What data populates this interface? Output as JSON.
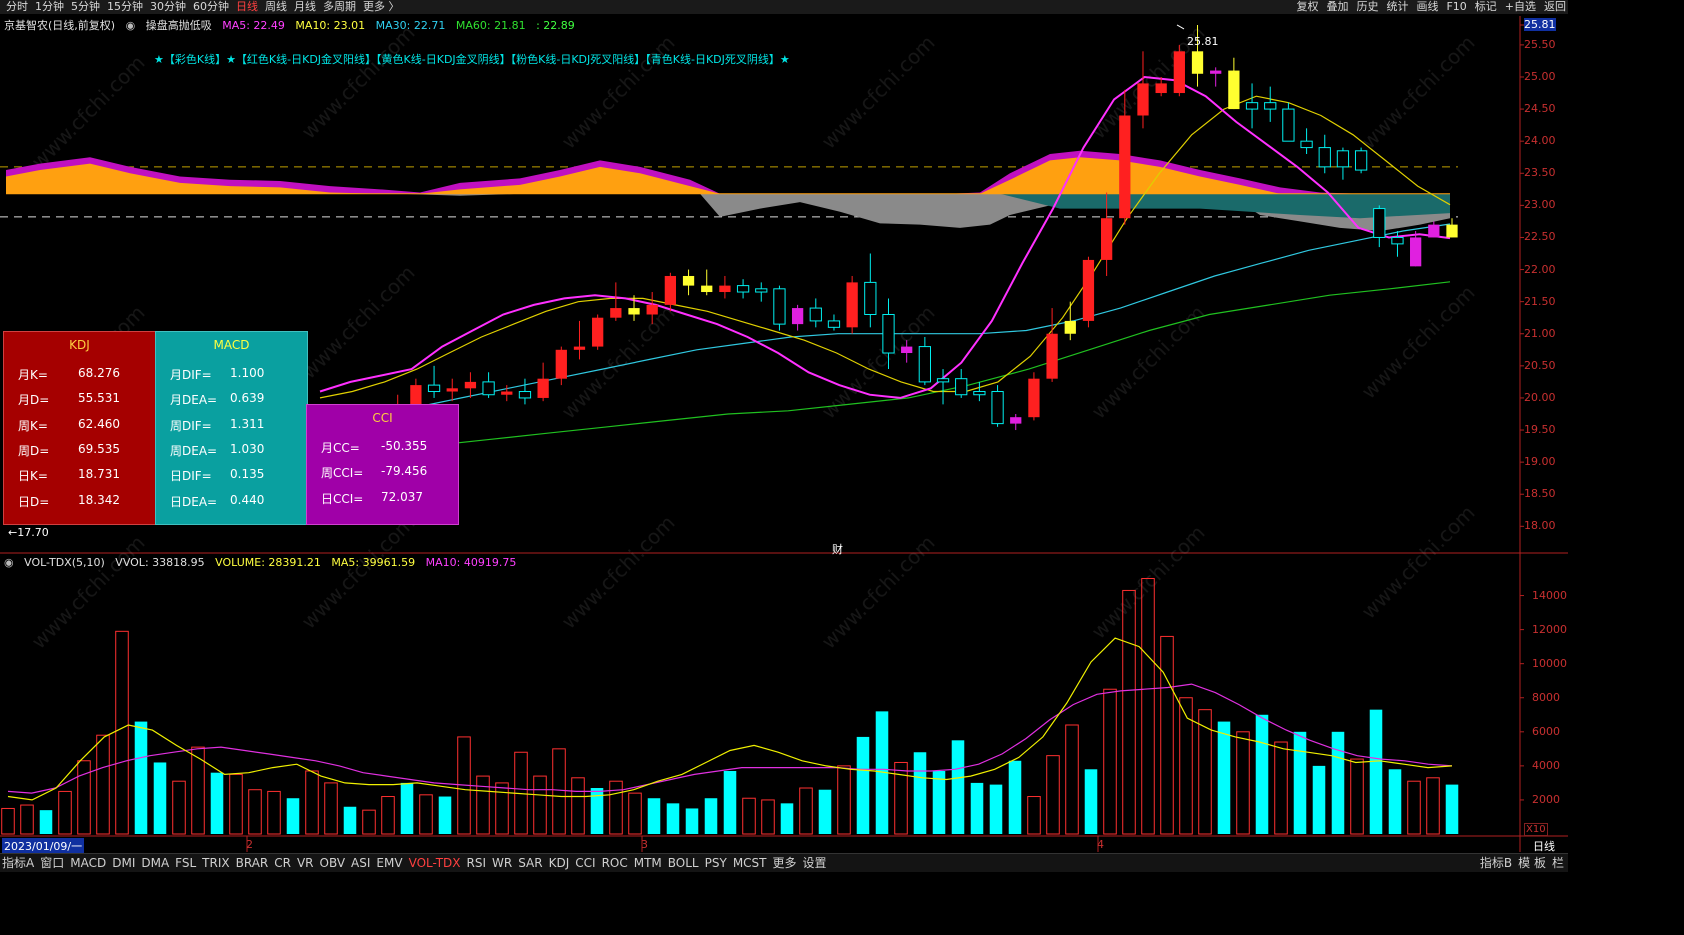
{
  "topbar": {
    "tabs": [
      "分时",
      "1分钟",
      "5分钟",
      "15分钟",
      "30分钟",
      "60分钟",
      "日线",
      "周线",
      "月线",
      "多周期",
      "更多 〉"
    ],
    "active_tab": "日线",
    "right_tools": [
      "复权",
      "叠加",
      "历史",
      "统计",
      "画线",
      "F10",
      "标记",
      "+自选",
      "返回"
    ]
  },
  "legend_main": {
    "stock": "京基智农(日线,前复权)",
    "indicator": "操盘高抛低吸",
    "ma5": "MA5: 22.49",
    "ma10": "MA10: 23.01",
    "ma30": "MA30: 22.71",
    "ma60": "MA60: 21.81",
    "extra": ": 22.89"
  },
  "kline_title": "★【彩色K线】★【红色K线-日KDJ金叉阳线】【黄色K线-日KDJ金叉阴线】【粉色K线-日KDJ死叉阳线】【青色K线-日KDJ死叉阴线】★",
  "price_axis": [
    "25.81",
    "25.50",
    "25.00",
    "24.50",
    "24.00",
    "23.50",
    "23.00",
    "22.50",
    "22.00",
    "21.50",
    "21.00",
    "20.50",
    "20.00",
    "19.50",
    "19.00",
    "18.50",
    "18.00"
  ],
  "vol_axis": [
    "14000",
    "12000",
    "10000",
    "8000",
    "6000",
    "4000",
    "2000"
  ],
  "vol_axis_unit": "X10",
  "markers": {
    "high": "25.81",
    "low": "17.70",
    "cai": "财"
  },
  "date_label": "2023/01/09/一",
  "month_marks": [
    "2",
    "3",
    "4"
  ],
  "period_label": "日线",
  "legend_vol": {
    "name": "VOL-TDX(5,10)",
    "vvol": "VVOL: 33818.95",
    "volume": "VOLUME: 28391.21",
    "ma5": "MA5: 39961.59",
    "ma10": "MA10: 40919.75"
  },
  "kdj_box": {
    "title": "KDJ",
    "rows": [
      [
        "月K=",
        "68.276"
      ],
      [
        "月D=",
        "55.531"
      ],
      [
        "周K=",
        "62.460"
      ],
      [
        "周D=",
        "69.535"
      ],
      [
        "日K=",
        "18.731"
      ],
      [
        "日D=",
        "18.342"
      ]
    ]
  },
  "macd_box": {
    "title": "MACD",
    "rows": [
      [
        "月DIF=",
        "1.100"
      ],
      [
        "月DEA=",
        "0.639"
      ],
      [
        "周DIF=",
        "1.311"
      ],
      [
        "周DEA=",
        "1.030"
      ],
      [
        "日DIF=",
        "0.135"
      ],
      [
        "日DEA=",
        "0.440"
      ]
    ]
  },
  "cci_box": {
    "title": "CCI",
    "rows": [
      [
        "月CC=",
        "-50.355"
      ],
      [
        "周CCI=",
        "-79.456"
      ],
      [
        "日CCI=",
        "72.037"
      ]
    ]
  },
  "bottombar": {
    "tabs": [
      "指标A",
      "窗口",
      "MACD",
      "DMI",
      "DMA",
      "FSL",
      "TRIX",
      "BRAR",
      "CR",
      "VR",
      "OBV",
      "ASI",
      "EMV",
      "VOL-TDX",
      "RSI",
      "WR",
      "SAR",
      "KDJ",
      "CCI",
      "ROC",
      "MTM",
      "BOLL",
      "PSY",
      "MCST",
      "更多",
      "设置"
    ],
    "active_tab": "VOL-TDX",
    "right": [
      "指标B",
      "模 板",
      "栏"
    ]
  },
  "colors": {
    "up": "#ff2020",
    "down": "#00f0f0",
    "gold": "#ffff30",
    "pink": "#e020e0",
    "ma30": "#30c8e0",
    "ma60": "#20c020",
    "axis": "#b02020"
  },
  "chart_data": {
    "type": "candlestick",
    "price_range": [
      17.6,
      25.95
    ],
    "volume_range": [
      0,
      15500
    ],
    "candles": [
      [
        18.95,
        19.1,
        18.85,
        19.05,
        "r"
      ],
      [
        19.05,
        19.55,
        18.95,
        19.4,
        "r"
      ],
      [
        19.4,
        19.7,
        19.25,
        19.6,
        "r"
      ],
      [
        19.6,
        19.9,
        19.45,
        19.7,
        "r"
      ],
      [
        19.7,
        20.05,
        19.6,
        19.9,
        "r"
      ],
      [
        19.9,
        20.3,
        19.8,
        20.2,
        "r"
      ],
      [
        20.2,
        20.5,
        20.0,
        20.1,
        "c"
      ],
      [
        20.1,
        20.3,
        19.95,
        20.15,
        "r"
      ],
      [
        20.15,
        20.4,
        20.0,
        20.25,
        "r"
      ],
      [
        20.25,
        20.4,
        20.0,
        20.05,
        "c"
      ],
      [
        20.05,
        20.2,
        19.95,
        20.1,
        "r"
      ],
      [
        20.1,
        20.3,
        19.9,
        20.0,
        "c"
      ],
      [
        20.0,
        20.55,
        19.95,
        20.3,
        "r"
      ],
      [
        20.3,
        20.8,
        20.2,
        20.75,
        "r"
      ],
      [
        20.75,
        21.2,
        20.6,
        20.8,
        "r"
      ],
      [
        20.8,
        21.3,
        20.75,
        21.25,
        "r"
      ],
      [
        21.25,
        21.8,
        21.2,
        21.4,
        "r"
      ],
      [
        21.4,
        21.6,
        21.2,
        21.3,
        "y"
      ],
      [
        21.3,
        21.65,
        21.15,
        21.45,
        "r"
      ],
      [
        21.45,
        21.95,
        21.35,
        21.9,
        "r"
      ],
      [
        21.9,
        22.0,
        21.6,
        21.75,
        "y"
      ],
      [
        21.75,
        22.0,
        21.6,
        21.65,
        "y"
      ],
      [
        21.65,
        21.9,
        21.55,
        21.75,
        "r"
      ],
      [
        21.75,
        21.85,
        21.55,
        21.65,
        "c"
      ],
      [
        21.65,
        21.8,
        21.5,
        21.7,
        "c"
      ],
      [
        21.7,
        21.75,
        21.05,
        21.15,
        "c"
      ],
      [
        21.15,
        21.45,
        21.05,
        21.4,
        "p"
      ],
      [
        21.4,
        21.55,
        21.1,
        21.2,
        "c"
      ],
      [
        21.2,
        21.3,
        21.05,
        21.1,
        "c"
      ],
      [
        21.1,
        21.9,
        21.0,
        21.8,
        "r"
      ],
      [
        21.8,
        22.25,
        21.1,
        21.3,
        "c"
      ],
      [
        21.3,
        21.55,
        20.45,
        20.7,
        "c"
      ],
      [
        20.7,
        20.9,
        20.55,
        20.8,
        "p"
      ],
      [
        20.8,
        20.95,
        20.2,
        20.25,
        "c"
      ],
      [
        20.25,
        20.45,
        19.9,
        20.3,
        "c"
      ],
      [
        20.3,
        20.45,
        20.0,
        20.05,
        "c"
      ],
      [
        20.05,
        20.25,
        19.95,
        20.1,
        "c"
      ],
      [
        20.1,
        20.2,
        19.55,
        19.6,
        "c"
      ],
      [
        19.6,
        19.75,
        19.5,
        19.7,
        "p"
      ],
      [
        19.7,
        20.4,
        19.65,
        20.3,
        "r"
      ],
      [
        20.3,
        21.4,
        20.25,
        21.0,
        "r"
      ],
      [
        21.0,
        21.5,
        20.9,
        21.2,
        "y"
      ],
      [
        21.2,
        22.2,
        21.1,
        22.15,
        "r"
      ],
      [
        22.15,
        23.2,
        21.9,
        22.8,
        "r"
      ],
      [
        22.8,
        24.8,
        22.7,
        24.4,
        "r"
      ],
      [
        24.4,
        25.4,
        24.2,
        24.9,
        "r"
      ],
      [
        24.9,
        25.0,
        24.7,
        24.75,
        "r"
      ],
      [
        24.75,
        25.5,
        24.7,
        25.4,
        "r"
      ],
      [
        25.4,
        25.81,
        24.85,
        25.05,
        "y"
      ],
      [
        25.05,
        25.15,
        24.85,
        25.1,
        "p"
      ],
      [
        25.1,
        25.3,
        24.5,
        24.5,
        "y"
      ],
      [
        24.5,
        24.9,
        24.2,
        24.6,
        "c"
      ],
      [
        24.6,
        24.85,
        24.3,
        24.5,
        "c"
      ],
      [
        24.5,
        24.6,
        24.0,
        24.0,
        "c"
      ],
      [
        24.0,
        24.2,
        23.8,
        23.9,
        "c"
      ],
      [
        23.9,
        24.1,
        23.5,
        23.6,
        "c"
      ],
      [
        23.6,
        23.9,
        23.4,
        23.85,
        "c"
      ],
      [
        23.85,
        23.9,
        23.5,
        23.55,
        "c"
      ],
      [
        22.95,
        23.0,
        22.35,
        22.5,
        "c"
      ],
      [
        22.5,
        22.6,
        22.2,
        22.4,
        "c"
      ],
      [
        22.05,
        22.6,
        22.05,
        22.5,
        "p"
      ],
      [
        22.5,
        22.75,
        22.5,
        22.7,
        "p"
      ],
      [
        22.7,
        22.8,
        22.5,
        22.5,
        "y"
      ]
    ],
    "volumes": [
      [
        1500,
        "r"
      ],
      [
        1700,
        "r"
      ],
      [
        1400,
        "c"
      ],
      [
        2500,
        "r"
      ],
      [
        4300,
        "r"
      ],
      [
        5800,
        "r"
      ],
      [
        11900,
        "r"
      ],
      [
        6600,
        "c"
      ],
      [
        4200,
        "c"
      ],
      [
        3100,
        "r"
      ],
      [
        5100,
        "r"
      ],
      [
        3600,
        "c"
      ],
      [
        3500,
        "r"
      ],
      [
        2600,
        "r"
      ],
      [
        2500,
        "r"
      ],
      [
        2100,
        "c"
      ],
      [
        3700,
        "r"
      ],
      [
        3000,
        "r"
      ],
      [
        1600,
        "c"
      ],
      [
        1400,
        "r"
      ],
      [
        2200,
        "r"
      ],
      [
        3000,
        "c"
      ],
      [
        2300,
        "r"
      ],
      [
        2200,
        "c"
      ],
      [
        5700,
        "r"
      ],
      [
        3400,
        "r"
      ],
      [
        3000,
        "r"
      ],
      [
        4800,
        "r"
      ],
      [
        3400,
        "r"
      ],
      [
        5000,
        "r"
      ],
      [
        3300,
        "r"
      ],
      [
        2700,
        "c"
      ],
      [
        3100,
        "r"
      ],
      [
        2400,
        "r"
      ],
      [
        2100,
        "c"
      ],
      [
        1800,
        "c"
      ],
      [
        1500,
        "c"
      ],
      [
        2100,
        "c"
      ],
      [
        3700,
        "c"
      ],
      [
        2100,
        "r"
      ],
      [
        2000,
        "r"
      ],
      [
        1800,
        "c"
      ],
      [
        2700,
        "r"
      ],
      [
        2600,
        "c"
      ],
      [
        4000,
        "r"
      ],
      [
        5700,
        "c"
      ],
      [
        7200,
        "c"
      ],
      [
        4200,
        "r"
      ],
      [
        4800,
        "c"
      ],
      [
        3700,
        "c"
      ],
      [
        5500,
        "c"
      ],
      [
        3000,
        "c"
      ],
      [
        2900,
        "c"
      ],
      [
        4300,
        "c"
      ],
      [
        2200,
        "r"
      ],
      [
        4600,
        "r"
      ],
      [
        6400,
        "r"
      ],
      [
        3800,
        "c"
      ],
      [
        8500,
        "r"
      ],
      [
        14300,
        "r"
      ],
      [
        15000,
        "r"
      ],
      [
        11600,
        "r"
      ],
      [
        8000,
        "r"
      ],
      [
        7300,
        "r"
      ],
      [
        6600,
        "c"
      ],
      [
        6000,
        "r"
      ],
      [
        7000,
        "c"
      ],
      [
        5400,
        "r"
      ],
      [
        6000,
        "c"
      ],
      [
        4000,
        "c"
      ],
      [
        6000,
        "c"
      ],
      [
        4400,
        "r"
      ],
      [
        7300,
        "c"
      ],
      [
        3800,
        "c"
      ],
      [
        3100,
        "r"
      ],
      [
        3300,
        "r"
      ],
      [
        2900,
        "c"
      ]
    ],
    "ma_values": {
      "ma5": [
        20.1,
        20.25,
        20.35,
        20.45,
        20.8,
        21.05,
        21.3,
        21.45,
        21.55,
        21.6,
        21.55,
        21.45,
        21.3,
        21.15,
        20.95,
        20.7,
        20.4,
        20.2,
        20.05,
        20.0,
        20.15,
        20.55,
        21.2,
        22.1,
        22.95,
        23.9,
        24.65,
        25.0,
        24.95,
        24.7,
        24.3,
        23.95,
        23.6,
        23.2,
        22.65,
        22.5,
        22.55,
        22.49
      ],
      "ma10": [
        20.0,
        20.1,
        20.25,
        20.45,
        20.7,
        20.95,
        21.15,
        21.35,
        21.5,
        21.55,
        21.55,
        21.45,
        21.35,
        21.2,
        21.05,
        20.9,
        20.7,
        20.45,
        20.25,
        20.1,
        20.1,
        20.25,
        20.65,
        21.25,
        22.0,
        22.8,
        23.5,
        24.1,
        24.5,
        24.7,
        24.6,
        24.4,
        24.1,
        23.7,
        23.3,
        23.01
      ],
      "ma30": [
        19.6,
        19.7,
        19.85,
        20.0,
        20.15,
        20.3,
        20.45,
        20.6,
        20.75,
        20.85,
        20.95,
        21.0,
        21.0,
        21.0,
        21.0,
        21.05,
        21.2,
        21.4,
        21.65,
        21.9,
        22.1,
        22.3,
        22.45,
        22.6,
        22.71
      ],
      "ma60": [
        18.55,
        18.65,
        18.75,
        18.85,
        18.95,
        19.05,
        19.15,
        19.25,
        19.35,
        19.45,
        19.55,
        19.65,
        19.75,
        19.8,
        19.9,
        20.0,
        20.2,
        20.45,
        20.75,
        21.05,
        21.3,
        21.45,
        21.6,
        21.7,
        21.81
      ]
    },
    "vol_ma5": [
      2200,
      2000,
      2700,
      4300,
      5700,
      6400,
      6100,
      5200,
      4400,
      3500,
      3600,
      3900,
      4100,
      3400,
      3000,
      2900,
      2900,
      3000,
      2800,
      2600,
      2500,
      2400,
      2300,
      2200,
      2200,
      2300,
      2600,
      3100,
      3500,
      4200,
      4900,
      5200,
      4800,
      4300,
      4000,
      3800,
      3700,
      3500,
      3300,
      3200,
      3400,
      3800,
      4500,
      5700,
      7700,
      10100,
      11500,
      11000,
      9500,
      6800,
      6100,
      5700,
      5400,
      5000,
      4800,
      4600,
      4200,
      4300,
      4100,
      3900,
      4000
    ],
    "vol_ma10": [
      2500,
      2400,
      2700,
      3400,
      3900,
      4300,
      4600,
      4800,
      5000,
      5100,
      4900,
      4700,
      4500,
      4300,
      4000,
      3600,
      3400,
      3200,
      3000,
      2900,
      2800,
      2700,
      2600,
      2600,
      2500,
      2500,
      2600,
      2900,
      3200,
      3500,
      3700,
      3900,
      3900,
      3900,
      3900,
      3900,
      3800,
      3800,
      3700,
      3700,
      3800,
      4100,
      4700,
      5600,
      6700,
      7600,
      8200,
      8400,
      8500,
      8600,
      8800,
      8300,
      7600,
      6800,
      6100,
      5500,
      5000,
      4600,
      4400,
      4300,
      4100,
      4000
    ]
  }
}
